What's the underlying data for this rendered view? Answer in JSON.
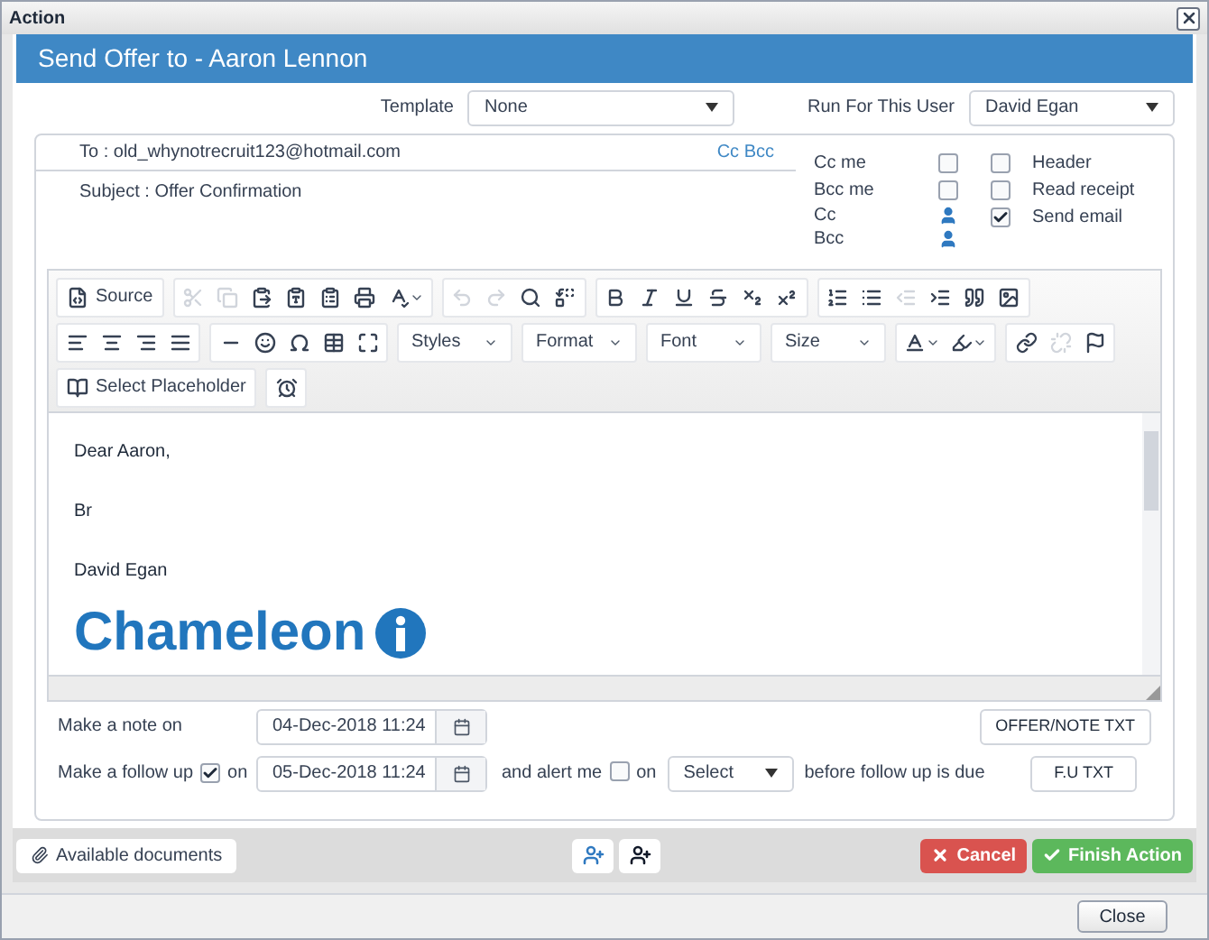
{
  "window": {
    "title": "Action"
  },
  "header": {
    "title": "Send Offer to - Aaron Lennon"
  },
  "template": {
    "label": "Template",
    "value": "None"
  },
  "run_for_user": {
    "label": "Run For This User",
    "value": "David Egan"
  },
  "email": {
    "to": "To : old_whynotrecruit123@hotmail.com",
    "cc_bcc_link": "Cc Bcc",
    "subject": "Subject : Offer Confirmation"
  },
  "options_left": [
    {
      "kind": "checkbox",
      "label": "Cc me",
      "checked": false
    },
    {
      "kind": "checkbox",
      "label": "Bcc me",
      "checked": false
    },
    {
      "kind": "person",
      "label": "Cc"
    },
    {
      "kind": "person",
      "label": "Bcc"
    }
  ],
  "options_right": [
    {
      "label": "Header",
      "checked": false
    },
    {
      "label": "Read receipt",
      "checked": false
    },
    {
      "label": "Send email",
      "checked": true
    }
  ],
  "toolbar": [
    [
      [
        {
          "kind": "label",
          "label": "Source",
          "disabled": false
        }
      ],
      [
        {
          "kind": "icon",
          "disabled": true
        },
        {
          "kind": "icon",
          "disabled": true
        },
        {
          "kind": "icon",
          "disabled": false
        },
        {
          "kind": "icon",
          "disabled": false
        },
        {
          "kind": "icon",
          "disabled": false
        },
        {
          "kind": "icon",
          "disabled": false
        },
        {
          "kind": "menu",
          "disabled": false
        }
      ],
      [
        {
          "kind": "icon",
          "disabled": true
        },
        {
          "kind": "icon",
          "disabled": true
        },
        {
          "kind": "icon",
          "disabled": false
        },
        {
          "kind": "icon",
          "disabled": false
        }
      ],
      [
        {
          "kind": "icon",
          "disabled": false
        },
        {
          "kind": "icon",
          "disabled": false
        },
        {
          "kind": "icon",
          "disabled": false
        },
        {
          "kind": "icon",
          "disabled": false
        },
        {
          "kind": "icon",
          "disabled": false
        },
        {
          "kind": "icon",
          "disabled": false
        }
      ],
      [
        {
          "kind": "icon",
          "disabled": false
        },
        {
          "kind": "icon",
          "disabled": false
        },
        {
          "kind": "icon",
          "disabled": true
        },
        {
          "kind": "icon",
          "disabled": false
        },
        {
          "kind": "icon",
          "disabled": false
        },
        {
          "kind": "icon",
          "disabled": false
        }
      ]
    ],
    [
      [
        {
          "kind": "icon",
          "disabled": false
        },
        {
          "kind": "icon",
          "disabled": false
        },
        {
          "kind": "icon",
          "disabled": false
        },
        {
          "kind": "icon",
          "disabled": false
        }
      ],
      [
        {
          "kind": "icon",
          "disabled": false
        },
        {
          "kind": "icon",
          "disabled": false
        },
        {
          "kind": "icon",
          "disabled": false
        },
        {
          "kind": "icon",
          "disabled": false
        },
        {
          "kind": "icon",
          "disabled": false
        }
      ],
      [
        {
          "kind": "combo",
          "label": "Styles",
          "disabled": false
        }
      ],
      [
        {
          "kind": "combo",
          "label": "Format",
          "disabled": false
        }
      ],
      [
        {
          "kind": "combo",
          "label": "Font",
          "disabled": false
        }
      ],
      [
        {
          "kind": "combo",
          "label": "Size",
          "disabled": false
        }
      ],
      [
        {
          "kind": "menu",
          "disabled": false
        },
        {
          "kind": "menu",
          "disabled": false
        }
      ],
      [
        {
          "kind": "icon",
          "disabled": false
        },
        {
          "kind": "icon",
          "disabled": true
        },
        {
          "kind": "icon",
          "disabled": false
        }
      ]
    ],
    [
      [
        {
          "kind": "label",
          "label": "Select Placeholder",
          "disabled": false
        }
      ],
      [
        {
          "kind": "icon",
          "disabled": false
        }
      ]
    ]
  ],
  "body": {
    "lines": [
      "Dear Aaron,",
      "Br",
      "David Egan"
    ],
    "logo": "Chameleon"
  },
  "note": {
    "label": "Make a note on",
    "date": "04-Dec-2018 11:24",
    "button": "OFFER/NOTE TXT"
  },
  "follow_up": {
    "label": "Make a follow up",
    "checked": true,
    "on": "on",
    "date": "05-Dec-2018 11:24",
    "alert_label": "and alert me",
    "alert_checked": false,
    "alert_on": "on",
    "select": "Select",
    "suffix": "before follow up is due",
    "button": "F.U TXT"
  },
  "actions": {
    "documents": "Available documents",
    "cancel": "Cancel",
    "finish": "Finish Action"
  },
  "footer": {
    "close": "Close"
  }
}
